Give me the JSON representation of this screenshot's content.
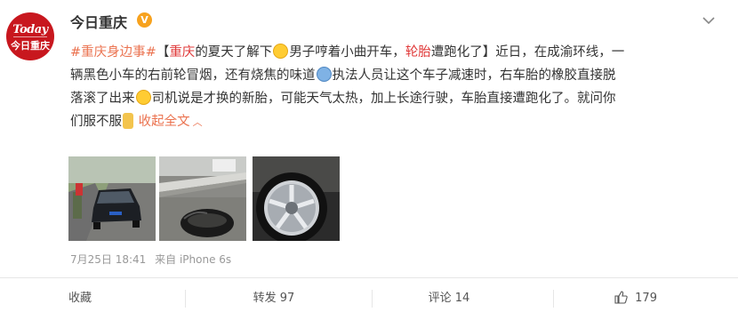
{
  "author": {
    "name": "今日重庆",
    "badge_icon": "verified-v-icon",
    "avatar": {
      "logo_top": "Today",
      "logo_bottom": "今日重庆"
    }
  },
  "post": {
    "lines": [
      [
        {
          "t": "#重庆身边事#",
          "k": "topic"
        },
        {
          "t": "【",
          "k": "text"
        },
        {
          "t": "重庆",
          "k": "red"
        },
        {
          "t": "的夏天了解下",
          "k": "text"
        },
        {
          "t": "laugh-emoji",
          "k": "emoji-laugh"
        },
        {
          "t": "男子哼着小曲开车，",
          "k": "text"
        },
        {
          "t": "轮胎",
          "k": "red"
        },
        {
          "t": "遭跑化了】近日，在成渝环线，一",
          "k": "text"
        }
      ],
      [
        {
          "t": "辆黑色小车的右前轮冒烟，还有烧焦的味道",
          "k": "text"
        },
        {
          "t": "shock-emoji",
          "k": "emoji-shock"
        },
        {
          "t": "执法人员让这个车子减速时，右车胎的橡胶直接脱",
          "k": "text"
        }
      ],
      [
        {
          "t": "落滚了出来",
          "k": "text"
        },
        {
          "t": "laugh-emoji",
          "k": "emoji-laugh"
        },
        {
          "t": "司机说是才换的新胎，可能天气太热，加上长途行驶，车胎直接遭跑化了。就问你",
          "k": "text"
        }
      ],
      [
        {
          "t": "们服不服",
          "k": "text"
        },
        {
          "t": "thumb-emoji",
          "k": "emoji-thumb"
        },
        {
          "t": " 收起全文",
          "k": "collapse"
        },
        {
          "t": "∧",
          "k": "collapse-icon"
        }
      ]
    ]
  },
  "images": [
    {
      "name": "photo-black-car-highway"
    },
    {
      "name": "photo-tire-rubber-on-road"
    },
    {
      "name": "photo-wheel-rim-closeup"
    }
  ],
  "meta": {
    "timestamp": "7月25日 18:41",
    "source": "来自 iPhone 6s"
  },
  "actions": {
    "favorite_label": "收藏",
    "repost_label": "转发 97",
    "comment_label": "评论 14",
    "like_count": "179"
  },
  "colors": {
    "link": "#eb7350",
    "highlight": "#e03a3a",
    "brand_red": "#c8171e",
    "badge": "#f7a21e"
  }
}
